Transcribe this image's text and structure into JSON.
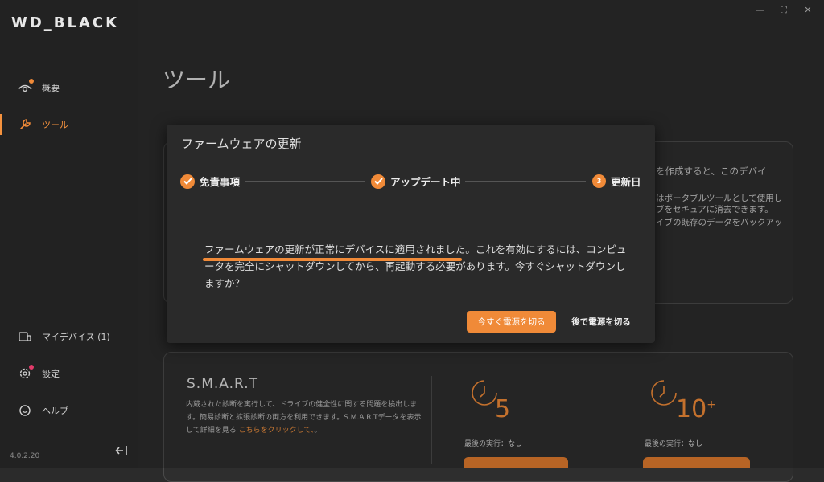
{
  "app": {
    "logo": "WD_BLACK",
    "version": "4.0.2.20"
  },
  "window_controls": {
    "minimize": "—",
    "maximize": "⛶",
    "close": "✕"
  },
  "sidebar": {
    "items": [
      {
        "label": "概要",
        "icon": "eye-icon",
        "badge": true
      },
      {
        "label": "ツール",
        "icon": "wrench-icon",
        "active": true
      },
      {
        "label": "マイデバイス (1)",
        "icon": "devices-icon"
      },
      {
        "label": "設定",
        "icon": "gear-icon",
        "badge": true
      },
      {
        "label": "ヘルプ",
        "icon": "help-icon"
      }
    ]
  },
  "main": {
    "title": "ツール",
    "right_card": {
      "line1": "を作成すると、このデバイ",
      "line2": "はポータブルツールとして使用し",
      "line3": "ブをセキュアに消去できます。",
      "line4": "イブの既存のデータをバックアッ"
    },
    "smart": {
      "title": "S.M.A.R.T",
      "desc": "内蔵された診断を実行して、ドライブの健全性に関する問題を検出します。簡易診断と拡張診断の両方を利用できます。S.M.A.R.Tデータを表示して詳細を見る",
      "link": "こちらをクリックして、",
      "link_tail": "。",
      "quick": {
        "value": "5",
        "last_run_label": "最後の実行：",
        "last_run_value": "なし"
      },
      "extended": {
        "value": "10",
        "sup": "+",
        "last_run_label": "最後の実行：",
        "last_run_value": "なし"
      }
    }
  },
  "modal": {
    "title": "ファームウェアの更新",
    "steps": [
      {
        "label": "免責事項",
        "state": "done"
      },
      {
        "label": "アップデート中",
        "state": "done"
      },
      {
        "label": "更新日",
        "number": "3",
        "state": "current"
      }
    ],
    "message_line1": "ファームウェアの更新が正常にデバイスに適用されました。これを有効にするには、コンピュ",
    "message_line2": "ータを完全にシャットダウンしてから、再起動する必要があります。今すぐシャットダウンし",
    "message_line3": "ますか？",
    "primary_button": "今すぐ電源を切る",
    "secondary_button": "後で電源を切る"
  },
  "colors": {
    "accent": "#f08a38",
    "background": "#2b2b2b",
    "sidebar": "#222222",
    "modal": "#2a2a2a"
  }
}
